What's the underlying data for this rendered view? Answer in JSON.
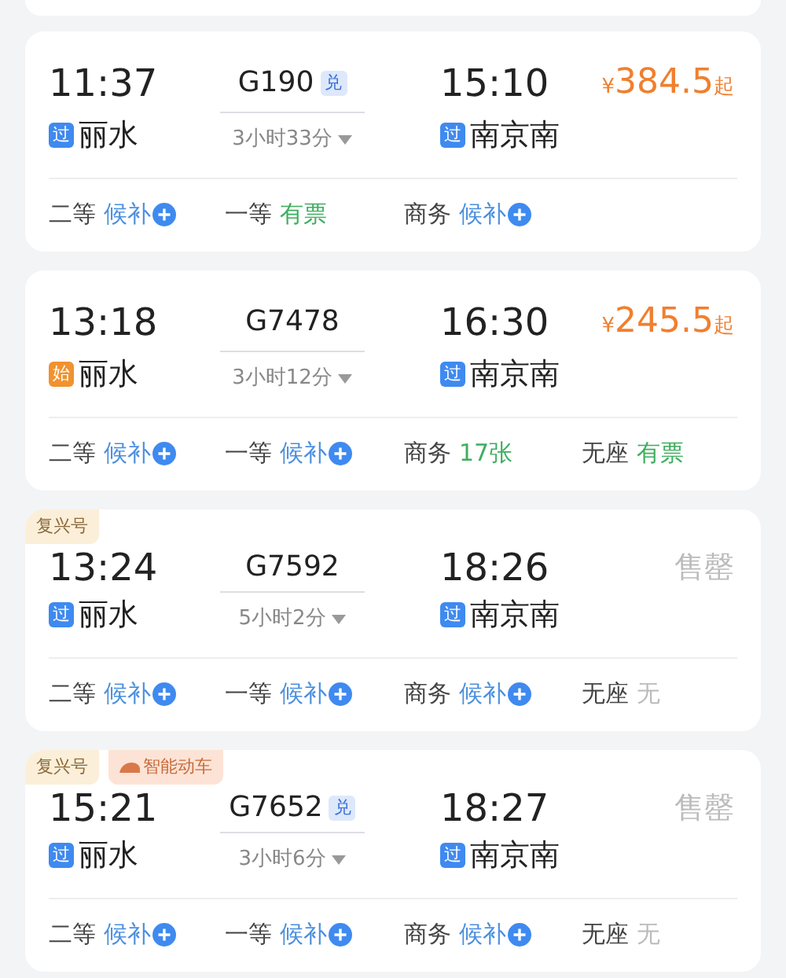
{
  "trains": [
    {
      "depart_time": "11:37",
      "train_no": "G190",
      "exchange_badge": "兑",
      "arrive_time": "15:10",
      "price": {
        "kind": "price",
        "currency": "¥",
        "amount": "384.5",
        "suffix": "起"
      },
      "depart_station": {
        "kind": "pass",
        "mark": "过",
        "name": "丽水"
      },
      "duration": "3小时33分",
      "arrive_station": {
        "kind": "pass",
        "mark": "过",
        "name": "南京南"
      },
      "seats": [
        {
          "class": "二等",
          "status": "候补",
          "kind": "waitlist"
        },
        {
          "class": "一等",
          "status": "有票",
          "kind": "available"
        },
        {
          "class": "商务",
          "status": "候补",
          "kind": "waitlist"
        }
      ]
    },
    {
      "depart_time": "13:18",
      "train_no": "G7478",
      "arrive_time": "16:30",
      "price": {
        "kind": "price",
        "currency": "¥",
        "amount": "245.5",
        "suffix": "起"
      },
      "depart_station": {
        "kind": "start",
        "mark": "始",
        "name": "丽水"
      },
      "duration": "3小时12分",
      "arrive_station": {
        "kind": "pass",
        "mark": "过",
        "name": "南京南"
      },
      "seats": [
        {
          "class": "二等",
          "status": "候补",
          "kind": "waitlist"
        },
        {
          "class": "一等",
          "status": "候补",
          "kind": "waitlist"
        },
        {
          "class": "商务",
          "status": "17张",
          "kind": "available"
        },
        {
          "class": "无座",
          "status": "有票",
          "kind": "available"
        }
      ]
    },
    {
      "tags": [
        {
          "kind": "fuxing",
          "text": "复兴号"
        }
      ],
      "depart_time": "13:24",
      "train_no": "G7592",
      "arrive_time": "18:26",
      "price": {
        "kind": "soldout",
        "text": "售罄"
      },
      "depart_station": {
        "kind": "pass",
        "mark": "过",
        "name": "丽水"
      },
      "duration": "5小时2分",
      "arrive_station": {
        "kind": "pass",
        "mark": "过",
        "name": "南京南"
      },
      "seats": [
        {
          "class": "二等",
          "status": "候补",
          "kind": "waitlist"
        },
        {
          "class": "一等",
          "status": "候补",
          "kind": "waitlist"
        },
        {
          "class": "商务",
          "status": "候补",
          "kind": "waitlist"
        },
        {
          "class": "无座",
          "status": "无",
          "kind": "none"
        }
      ]
    },
    {
      "tags": [
        {
          "kind": "fuxing",
          "text": "复兴号"
        },
        {
          "kind": "smart",
          "text": "智能动车"
        }
      ],
      "depart_time": "15:21",
      "train_no": "G7652",
      "exchange_badge": "兑",
      "arrive_time": "18:27",
      "price": {
        "kind": "soldout",
        "text": "售罄"
      },
      "depart_station": {
        "kind": "pass",
        "mark": "过",
        "name": "丽水"
      },
      "duration": "3小时6分",
      "arrive_station": {
        "kind": "pass",
        "mark": "过",
        "name": "南京南"
      },
      "seats": [
        {
          "class": "二等",
          "status": "候补",
          "kind": "waitlist"
        },
        {
          "class": "一等",
          "status": "候补",
          "kind": "waitlist"
        },
        {
          "class": "商务",
          "status": "候补",
          "kind": "waitlist"
        },
        {
          "class": "无座",
          "status": "无",
          "kind": "none"
        }
      ]
    }
  ]
}
